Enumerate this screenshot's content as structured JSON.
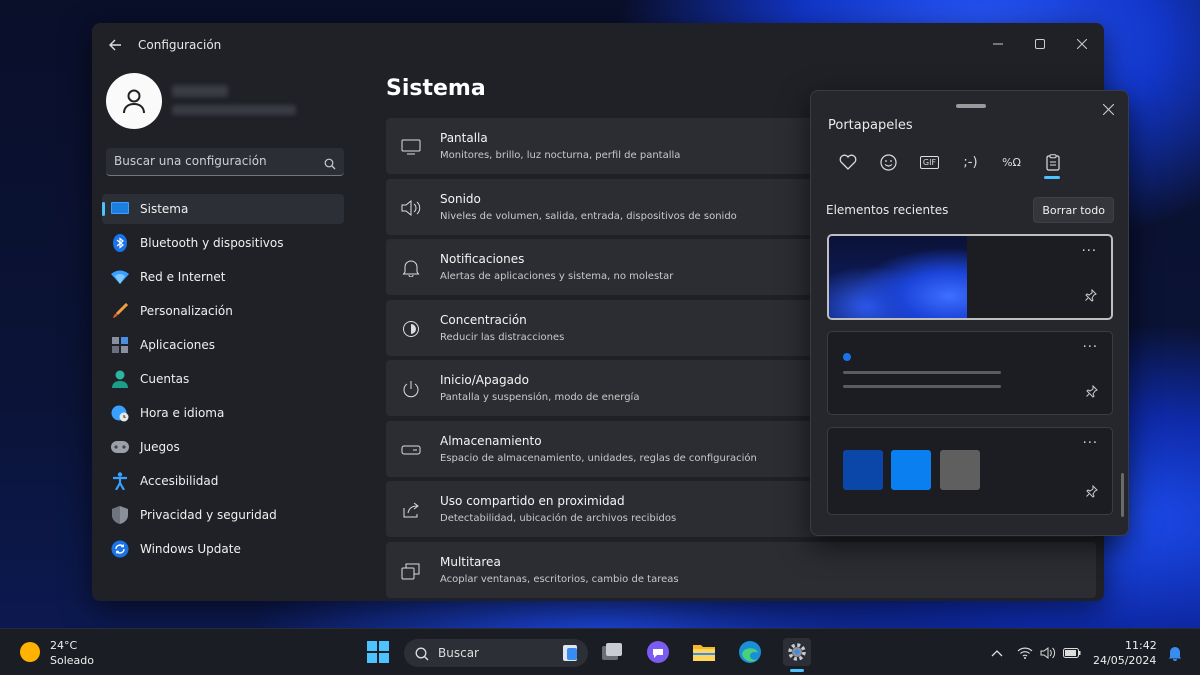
{
  "window": {
    "title": "Configuración",
    "page_title": "Sistema",
    "search_placeholder": "Buscar una configuración"
  },
  "sidebar": {
    "items": [
      {
        "label": "Sistema",
        "icon": "monitor-icon",
        "active": true
      },
      {
        "label": "Bluetooth y dispositivos",
        "icon": "bluetooth-icon"
      },
      {
        "label": "Red e Internet",
        "icon": "wifi-diamond-icon"
      },
      {
        "label": "Personalización",
        "icon": "brush-icon"
      },
      {
        "label": "Aplicaciones",
        "icon": "apps-icon"
      },
      {
        "label": "Cuentas",
        "icon": "person-icon"
      },
      {
        "label": "Hora e idioma",
        "icon": "globe-clock-icon"
      },
      {
        "label": "Juegos",
        "icon": "gamepad-icon"
      },
      {
        "label": "Accesibilidad",
        "icon": "accessibility-icon"
      },
      {
        "label": "Privacidad y seguridad",
        "icon": "shield-icon"
      },
      {
        "label": "Windows Update",
        "icon": "update-icon"
      }
    ]
  },
  "settings_cards": [
    {
      "title": "Pantalla",
      "subtitle": "Monitores, brillo, luz nocturna, perfil de pantalla",
      "icon": "display-icon"
    },
    {
      "title": "Sonido",
      "subtitle": "Niveles de volumen, salida, entrada, dispositivos de sonido",
      "icon": "speaker-icon"
    },
    {
      "title": "Notificaciones",
      "subtitle": "Alertas de aplicaciones y sistema, no molestar",
      "icon": "bell-icon"
    },
    {
      "title": "Concentración",
      "subtitle": "Reducir las distracciones",
      "icon": "focus-icon"
    },
    {
      "title": "Inicio/Apagado",
      "subtitle": "Pantalla y suspensión, modo de energía",
      "icon": "power-icon"
    },
    {
      "title": "Almacenamiento",
      "subtitle": "Espacio de almacenamiento, unidades, reglas de configuración",
      "icon": "storage-icon"
    },
    {
      "title": "Uso compartido en proximidad",
      "subtitle": "Detectabilidad, ubicación de archivos recibidos",
      "icon": "share-icon"
    },
    {
      "title": "Multitarea",
      "subtitle": "Acoplar ventanas, escritorios, cambio de tareas",
      "icon": "multitask-icon"
    }
  ],
  "clipboard": {
    "title": "Portapapeles",
    "tabs": [
      {
        "icon": "heart-emoji-icon"
      },
      {
        "icon": "emoji-icon"
      },
      {
        "icon": "gif-icon",
        "label": "GIF"
      },
      {
        "icon": "kaomoji-icon",
        "label": ";-)"
      },
      {
        "icon": "symbols-icon",
        "label": "%Ω"
      },
      {
        "icon": "clipboard-icon",
        "active": true
      }
    ],
    "recent_label": "Elementos recientes",
    "clear_all": "Borrar todo",
    "more_glyph": "···",
    "swatch_colors": [
      "#0a47a8",
      "#0a7ff0",
      "#5f5f5f"
    ]
  },
  "taskbar": {
    "weather_temp": "24°C",
    "weather_condition": "Soleado",
    "search_label": "Buscar",
    "time": "11:42",
    "date": "24/05/2024"
  },
  "colors": {
    "accent": "#4cc2ff",
    "window_bg": "#1f2127",
    "card_bg": "#2b2d33"
  }
}
